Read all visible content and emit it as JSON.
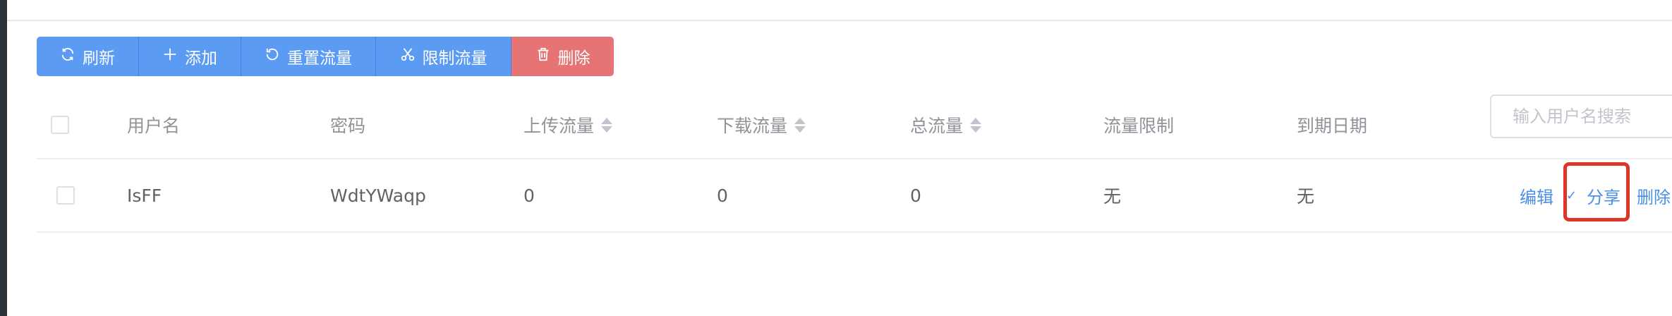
{
  "toolbar": {
    "refresh": "刷新",
    "add": "添加",
    "reset_traffic": "重置流量",
    "limit_traffic": "限制流量",
    "delete": "删除"
  },
  "table": {
    "headers": {
      "username": "用户名",
      "password": "密码",
      "upload": "上传流量",
      "download": "下载流量",
      "total": "总流量",
      "limit": "流量限制",
      "expiry": "到期日期"
    },
    "search_placeholder": "输入用户名搜索",
    "rows": [
      {
        "username": "IsFF",
        "password": "WdtYWaqp",
        "upload": "0",
        "download": "0",
        "total": "0",
        "limit": "无",
        "expiry": "无",
        "actions": {
          "edit": "编辑",
          "separator": "✓",
          "share": "分享",
          "delete": "删除"
        }
      }
    ]
  },
  "colors": {
    "primary": "#5b9bf3",
    "danger": "#e77474",
    "link": "#4a90e2",
    "highlight": "#e0342b"
  }
}
